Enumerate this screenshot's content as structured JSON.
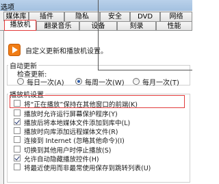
{
  "window": {
    "title": "选项"
  },
  "tabs_row1": [
    {
      "label": "媒体库"
    },
    {
      "label": "插件"
    },
    {
      "label": "隐私"
    },
    {
      "label": "安全"
    },
    {
      "label": "DVD"
    },
    {
      "label": "网络"
    }
  ],
  "tabs_row2": [
    {
      "label": "播放机"
    },
    {
      "label": "翻录音乐"
    },
    {
      "label": "设备"
    },
    {
      "label": "刻录"
    },
    {
      "label": "性能"
    }
  ],
  "intro": "自定义更新和播放机设置。",
  "auto_update": {
    "title": "自动更新",
    "check_label": "检查更新:",
    "options": [
      {
        "label": "每日一次(A)",
        "selected": false
      },
      {
        "label": "每周一次(W)",
        "selected": true
      },
      {
        "label": "每月一次(T)",
        "selected": false
      }
    ]
  },
  "player_settings": {
    "title": "播放机设置",
    "items": [
      {
        "label": "将“正在播放”保持在其他窗口的前端(K)",
        "checked": false
      },
      {
        "label": "播放时允许运行屏幕保护程序(Y)",
        "checked": false
      },
      {
        "label": "播放后将本地媒体文件添加到库中(L)",
        "checked": true
      },
      {
        "label": "播放时向库添加远程媒体文件(R)",
        "checked": false
      },
      {
        "label": "连接到 Internet (忽略其他命令)(I)",
        "checked": false
      },
      {
        "label": "切换到其他用户时停止播放(S)",
        "checked": false
      },
      {
        "label": "允许自动隐藏播放控件(H)",
        "checked": true
      },
      {
        "label": "将最近使用而非最常使用保存到跳转列表(U)",
        "checked": false
      }
    ]
  },
  "colors": {
    "highlight": "#e23b3b",
    "accent": "#2a5aa8"
  }
}
